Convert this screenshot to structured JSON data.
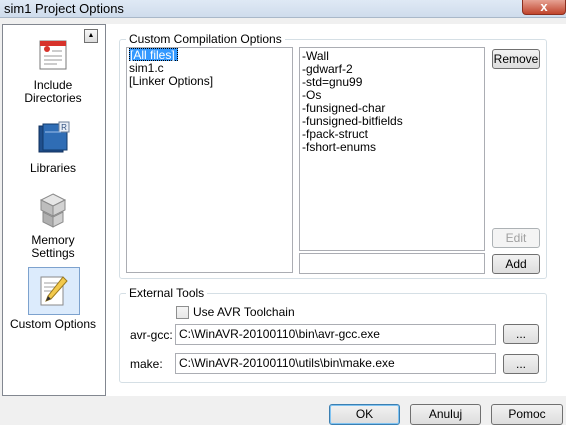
{
  "window": {
    "title": "sim1 Project Options",
    "close_glyph": "x"
  },
  "sidebar": {
    "items": [
      {
        "label_line1": "Include",
        "label_line2": "Directories",
        "icon": "include-directories-icon",
        "selected": false
      },
      {
        "label_line1": "Libraries",
        "label_line2": "",
        "icon": "libraries-icon",
        "selected": false
      },
      {
        "label_line1": "Memory",
        "label_line2": "Settings",
        "icon": "memory-settings-icon",
        "selected": false
      },
      {
        "label_line1": "Custom Options",
        "label_line2": "",
        "icon": "custom-options-icon",
        "selected": true
      }
    ]
  },
  "custom_compilation": {
    "legend": "Custom Compilation Options",
    "files": [
      "[All files]",
      "sim1.c",
      "[Linker Options]"
    ],
    "selected_file": "[All files]",
    "options": [
      "-Wall",
      "-gdwarf-2",
      "-std=gnu99",
      "-Os",
      "-funsigned-char",
      "-funsigned-bitfields",
      "-fpack-struct",
      "-fshort-enums"
    ],
    "remove_label": "Remove",
    "edit_label": "Edit",
    "add_label": "Add",
    "new_option_value": ""
  },
  "external_tools": {
    "legend": "External Tools",
    "use_avr_label": "Use AVR Toolchain",
    "use_avr_checked": false,
    "avr_gcc_label": "avr-gcc:",
    "avr_gcc_path": "C:\\WinAVR-20100110\\bin\\avr-gcc.exe",
    "make_label": "make:",
    "make_path": "C:\\WinAVR-20100110\\utils\\bin\\make.exe",
    "browse_label": "..."
  },
  "buttons": {
    "ok": "OK",
    "cancel": "Anuluj",
    "help": "Pomoc"
  }
}
